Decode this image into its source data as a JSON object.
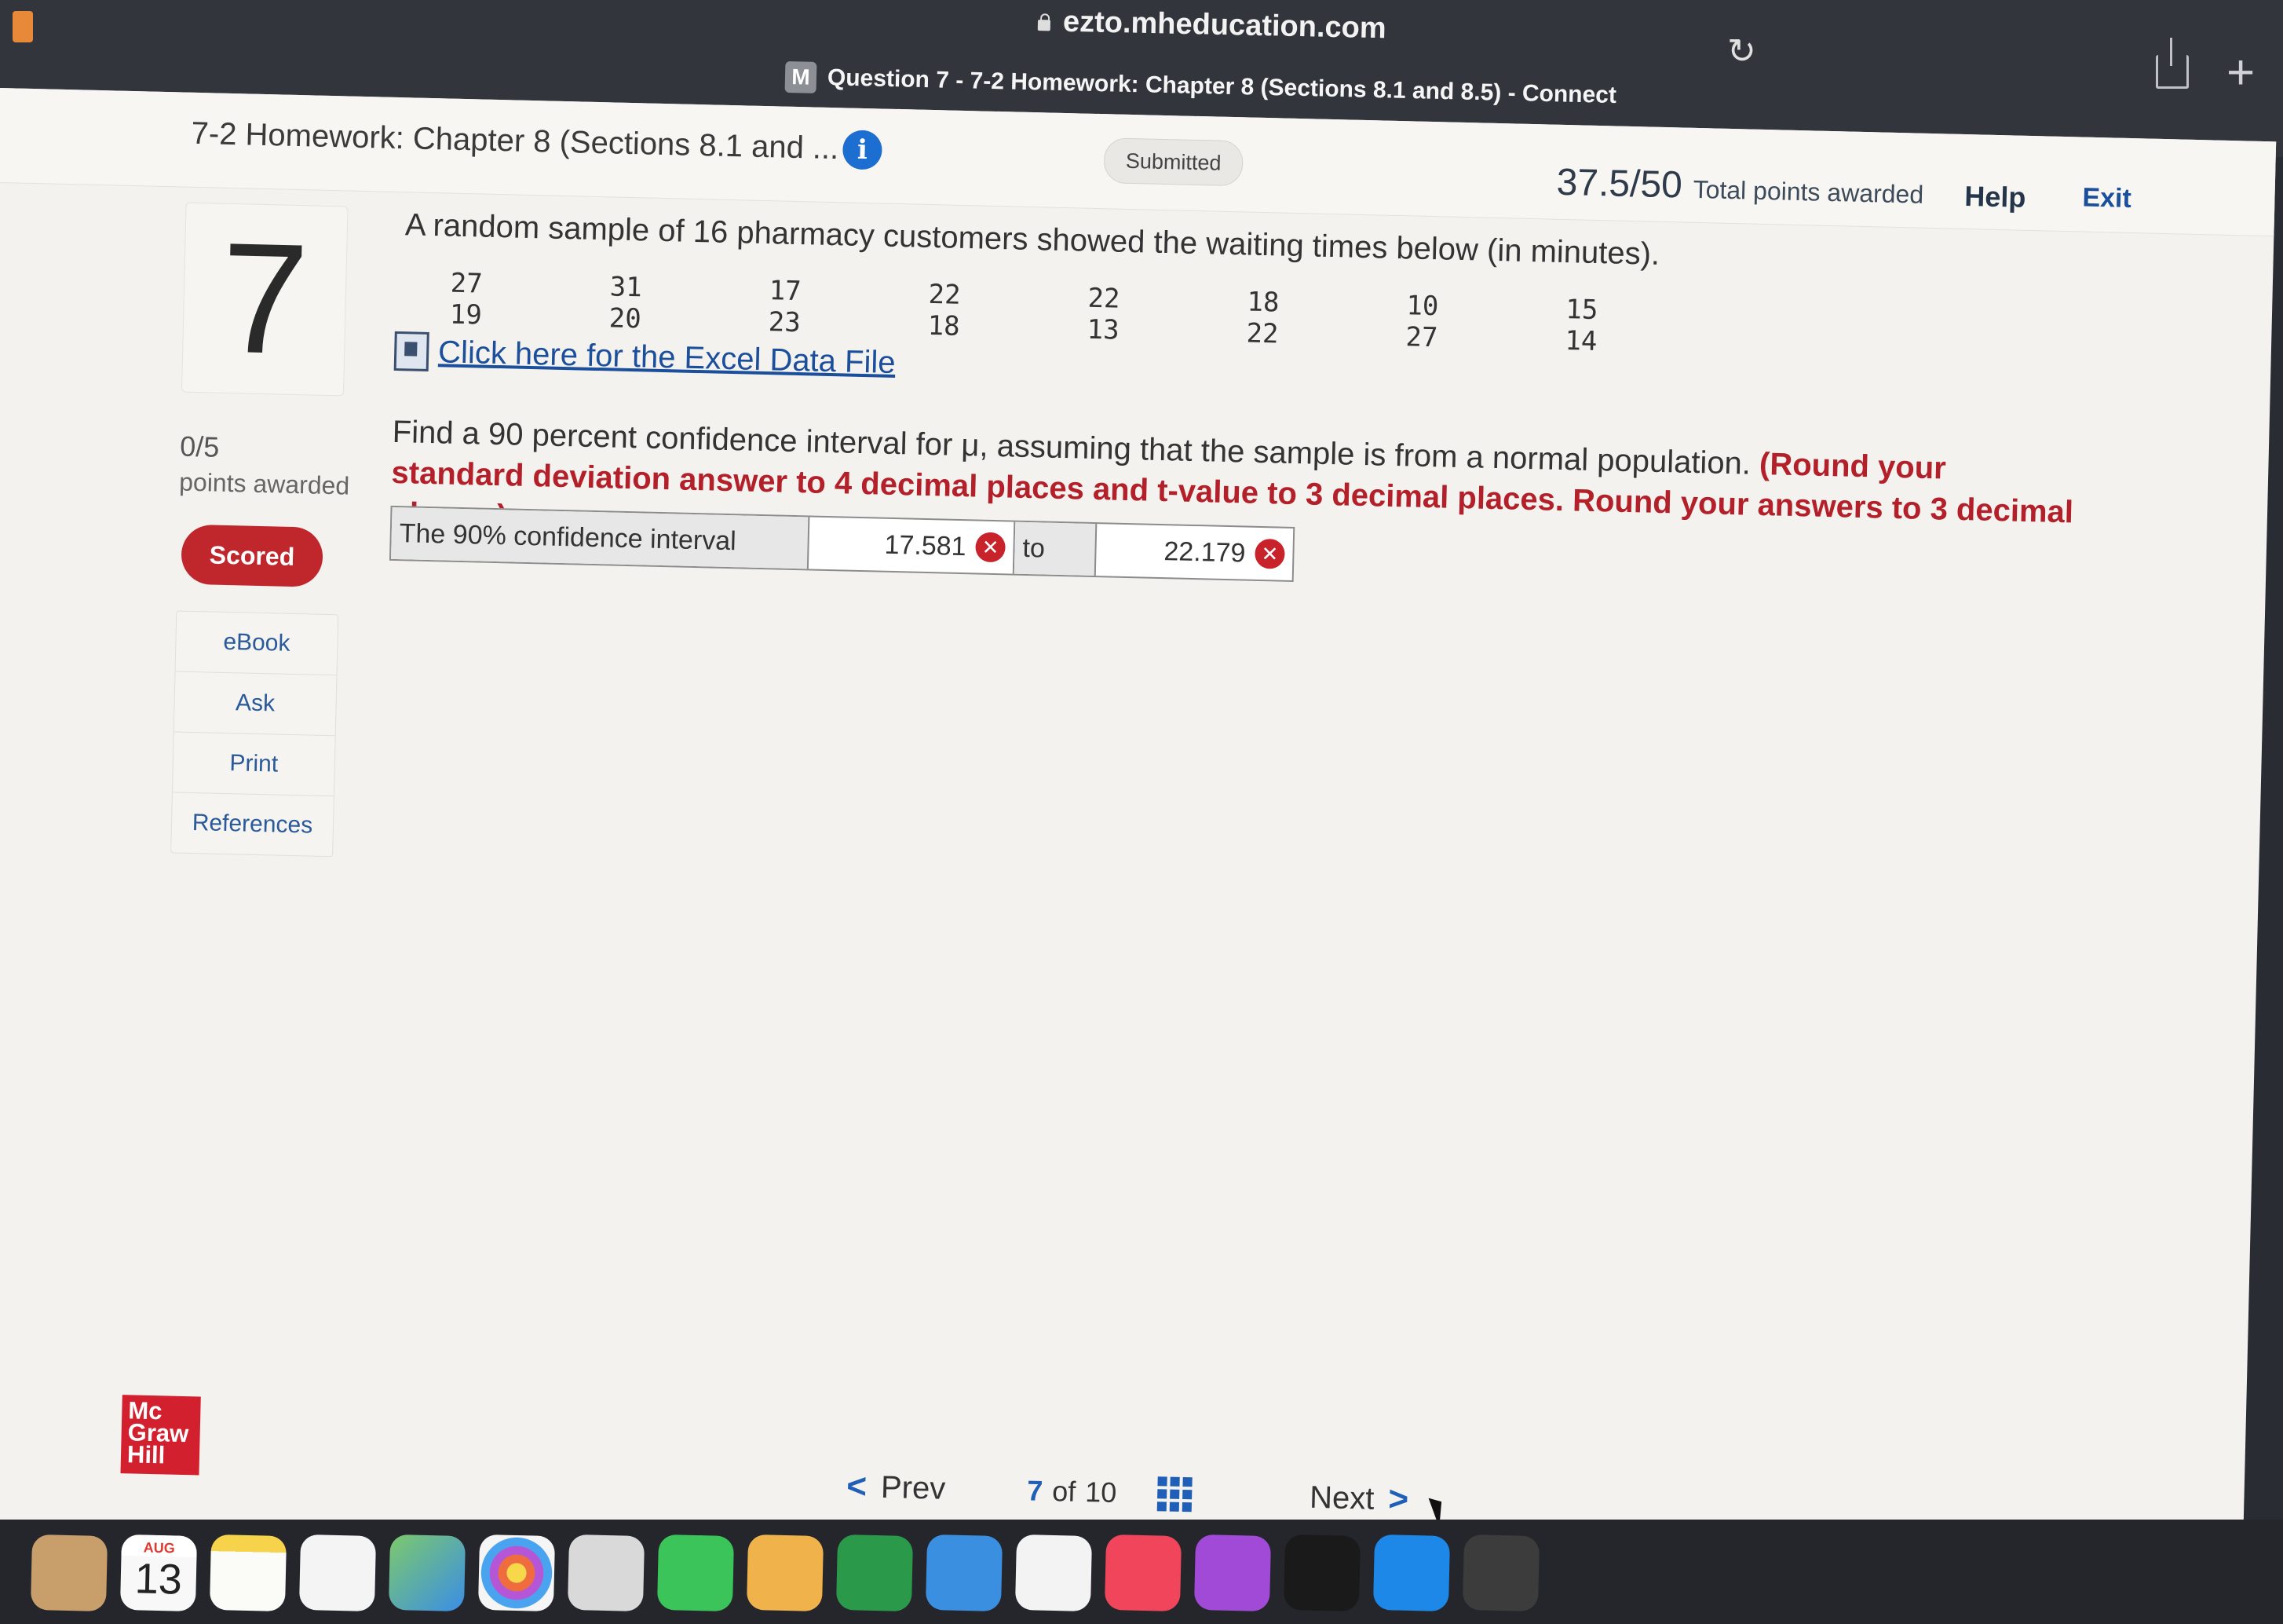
{
  "browser": {
    "url": "ezto.mheducation.com",
    "tab_favicon": "M",
    "tab_title": "Question 7 - 7-2 Homework: Chapter 8 (Sections 8.1 and 8.5) - Connect"
  },
  "header": {
    "assignment_title": "7-2 Homework: Chapter 8 (Sections 8.1 and ...",
    "info_symbol": "i",
    "status": "Submitted",
    "score_value": "37.5/50",
    "score_label": "Total points awarded",
    "help": "Help",
    "exit": "Exit"
  },
  "sidebar": {
    "question_number": "7",
    "points_fraction": "0/5",
    "points_label": "points awarded",
    "scored_label": "Scored",
    "tools": [
      "eBook",
      "Ask",
      "Print",
      "References"
    ]
  },
  "question": {
    "intro": "A random sample of 16 pharmacy customers showed the waiting times below (in minutes).",
    "data_columns": [
      [
        "27",
        "19"
      ],
      [
        "31",
        "20"
      ],
      [
        "17",
        "23"
      ],
      [
        "22",
        "18"
      ],
      [
        "22",
        "13"
      ],
      [
        "18",
        "22"
      ],
      [
        "10",
        "27"
      ],
      [
        "15",
        "14"
      ]
    ],
    "excel_link": "Click here for the Excel Data File",
    "prompt_plain": "Find a 90 percent confidence interval for μ, assuming that the sample is from a normal population. ",
    "prompt_bold": "(Round your standard deviation answer to 4 decimal places and t-value to 3 decimal places. Round your answers to 3 decimal places.)"
  },
  "answer": {
    "label": "The 90% confidence interval",
    "lower": "17.581",
    "connector": "to",
    "upper": "22.179",
    "status_icon": "incorrect-x-icon"
  },
  "footer": {
    "logo_lines": [
      "Mc",
      "Graw",
      "Hill"
    ],
    "prev": "Prev",
    "current_page": "7",
    "of_label": "of",
    "total_pages": "10",
    "next": "Next"
  },
  "dock": {
    "calendar_month": "AUG",
    "calendar_day": "13"
  },
  "colors": {
    "scored_red": "#c0272d",
    "link_blue": "#1b4e9b",
    "error_red": "#c8232b",
    "info_blue": "#1c6fd1"
  }
}
